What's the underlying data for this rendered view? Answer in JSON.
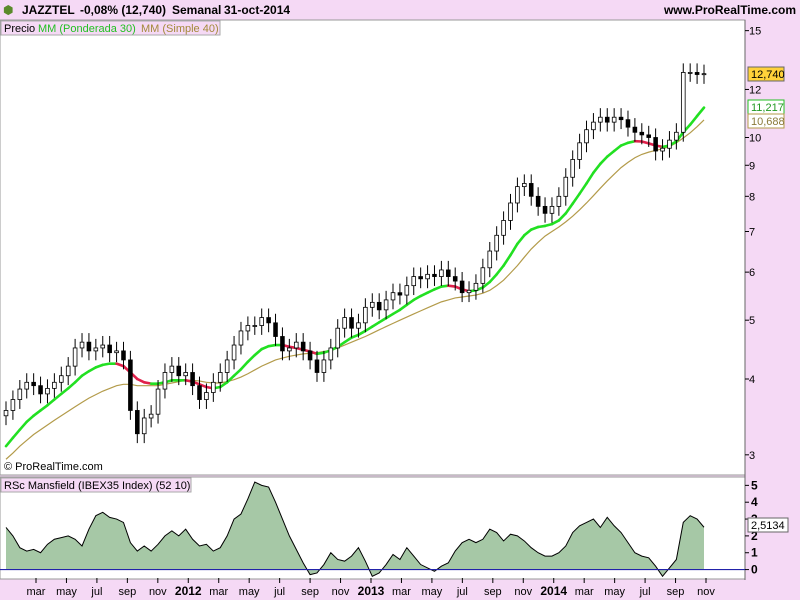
{
  "header": {
    "symbol": "JAZZTEL",
    "change": "-0,08% (12,740)",
    "period": "Semanal",
    "date": "31-oct-2014",
    "site": "www.ProRealTime.com"
  },
  "legend": {
    "price": "Precio",
    "ma1": "MM (Ponderada 30)",
    "ma2": "MM (Simple 40)"
  },
  "watermark": "© ProRealTime.com",
  "indicator_title": "RSc Mansfield (IBEX35 Index) (52 10)",
  "colors": {
    "background": "#f5d9f5",
    "ma1_up": "#22e022",
    "ma1_down": "#e0204a",
    "ma2": "#b39b4a",
    "candle": "#000000",
    "rsc_fill": "#5d9a5d",
    "rsc_zero": "#2222aa"
  },
  "chart_data": [
    {
      "type": "line",
      "panel": "price",
      "scale": "log",
      "ylim": [
        2.8,
        15.5
      ],
      "y_ticks": [
        3,
        4,
        5,
        6,
        7,
        8,
        9,
        10,
        12,
        15
      ],
      "x_ticks": [
        "mar",
        "may",
        "jul",
        "sep",
        "nov",
        "2012",
        "mar",
        "may",
        "jul",
        "sep",
        "nov",
        "2013",
        "mar",
        "may",
        "jul",
        "sep",
        "nov",
        "2014",
        "mar",
        "may",
        "jul",
        "sep",
        "nov"
      ],
      "x_ticks_bold": [
        "2012",
        "2013",
        "2014"
      ],
      "last_price": "12,740",
      "ma1_last": "11,217",
      "ma2_last": "10,688",
      "series": [
        {
          "name": "Precio",
          "values": [
            3.55,
            3.7,
            3.85,
            3.95,
            3.9,
            3.78,
            3.86,
            3.95,
            4.05,
            4.2,
            4.5,
            4.6,
            4.45,
            4.5,
            4.55,
            4.42,
            4.45,
            4.3,
            3.55,
            3.25,
            3.45,
            3.5,
            3.85,
            4.1,
            4.2,
            4.05,
            4.1,
            3.9,
            3.7,
            3.8,
            3.95,
            4.1,
            4.3,
            4.55,
            4.8,
            4.9,
            4.9,
            5.05,
            4.95,
            4.7,
            4.45,
            4.5,
            4.6,
            4.45,
            4.3,
            4.1,
            4.3,
            4.5,
            4.85,
            5.05,
            4.85,
            4.95,
            5.25,
            5.35,
            5.2,
            5.4,
            5.55,
            5.5,
            5.7,
            5.9,
            5.85,
            5.95,
            5.9,
            6.05,
            5.9,
            5.8,
            5.55,
            5.6,
            5.75,
            6.1,
            6.5,
            6.9,
            7.3,
            7.8,
            8.3,
            8.4,
            8.0,
            7.7,
            7.5,
            7.7,
            8.0,
            8.6,
            9.2,
            9.8,
            10.3,
            10.6,
            10.8,
            10.6,
            10.8,
            10.7,
            10.4,
            10.2,
            10.1,
            10.0,
            9.5,
            9.6,
            9.9,
            10.2,
            12.8,
            12.8,
            12.7,
            12.74
          ]
        },
        {
          "name": "MM (Ponderada 30)",
          "values": [
            3.1,
            3.2,
            3.3,
            3.4,
            3.48,
            3.55,
            3.62,
            3.7,
            3.78,
            3.86,
            3.95,
            4.05,
            4.12,
            4.18,
            4.22,
            4.24,
            4.24,
            4.2,
            4.1,
            4.0,
            3.95,
            3.93,
            3.93,
            3.95,
            3.98,
            3.98,
            3.98,
            3.96,
            3.92,
            3.88,
            3.86,
            3.88,
            3.95,
            4.05,
            4.15,
            4.27,
            4.38,
            4.48,
            4.53,
            4.55,
            4.55,
            4.52,
            4.5,
            4.47,
            4.44,
            4.4,
            4.42,
            4.46,
            4.52,
            4.6,
            4.68,
            4.73,
            4.8,
            4.88,
            4.96,
            5.04,
            5.12,
            5.2,
            5.3,
            5.4,
            5.48,
            5.55,
            5.62,
            5.68,
            5.7,
            5.68,
            5.62,
            5.58,
            5.6,
            5.66,
            5.78,
            5.95,
            6.15,
            6.4,
            6.68,
            6.9,
            7.05,
            7.12,
            7.15,
            7.2,
            7.3,
            7.5,
            7.78,
            8.08,
            8.4,
            8.75,
            9.05,
            9.3,
            9.5,
            9.7,
            9.8,
            9.86,
            9.85,
            9.78,
            9.7,
            9.65,
            9.7,
            9.85,
            10.2,
            10.5,
            10.85,
            11.2
          ]
        },
        {
          "name": "MM (Simple 40)",
          "values": [
            2.95,
            3.02,
            3.1,
            3.17,
            3.24,
            3.3,
            3.36,
            3.42,
            3.48,
            3.54,
            3.6,
            3.66,
            3.72,
            3.77,
            3.82,
            3.86,
            3.9,
            3.92,
            3.92,
            3.9,
            3.9,
            3.9,
            3.9,
            3.92,
            3.94,
            3.96,
            3.98,
            3.98,
            3.97,
            3.95,
            3.94,
            3.94,
            3.96,
            3.99,
            4.03,
            4.08,
            4.14,
            4.2,
            4.25,
            4.3,
            4.33,
            4.36,
            4.38,
            4.4,
            4.41,
            4.42,
            4.44,
            4.46,
            4.5,
            4.55,
            4.6,
            4.65,
            4.7,
            4.76,
            4.82,
            4.88,
            4.94,
            5.0,
            5.06,
            5.12,
            5.18,
            5.24,
            5.3,
            5.36,
            5.4,
            5.44,
            5.46,
            5.48,
            5.5,
            5.54,
            5.6,
            5.7,
            5.82,
            5.98,
            6.15,
            6.35,
            6.55,
            6.72,
            6.88,
            7.0,
            7.12,
            7.26,
            7.42,
            7.6,
            7.8,
            8.02,
            8.25,
            8.48,
            8.7,
            8.92,
            9.1,
            9.26,
            9.38,
            9.46,
            9.52,
            9.58,
            9.66,
            9.8,
            9.98,
            10.18,
            10.42,
            10.69
          ]
        }
      ]
    },
    {
      "type": "area",
      "panel": "indicator",
      "ylim": [
        -0.5,
        5.2
      ],
      "y_ticks": [
        "5",
        "4",
        "3",
        "2",
        "1",
        "0"
      ],
      "last_value": "2,5134",
      "series": [
        {
          "name": "RSc Mansfield (IBEX35 Index)",
          "values": [
            2.5,
            2.0,
            1.3,
            1.1,
            1.2,
            1.0,
            1.5,
            1.8,
            1.9,
            2.0,
            1.8,
            1.4,
            2.4,
            3.2,
            3.4,
            3.1,
            3.0,
            2.8,
            1.6,
            1.1,
            1.4,
            1.1,
            1.5,
            2.0,
            2.3,
            2.0,
            2.4,
            1.8,
            1.4,
            1.5,
            1.1,
            1.3,
            2.0,
            3.0,
            3.3,
            4.2,
            5.2,
            5.0,
            4.9,
            4.0,
            3.0,
            2.0,
            1.2,
            0.4,
            -0.3,
            -0.2,
            0.3,
            1.0,
            0.6,
            0.5,
            0.8,
            1.3,
            0.5,
            -0.4,
            -0.2,
            0.3,
            0.9,
            0.6,
            1.3,
            0.8,
            0.3,
            0.1,
            -0.1,
            0.2,
            0.4,
            1.1,
            1.6,
            1.8,
            1.6,
            1.8,
            2.4,
            2.2,
            1.7,
            2.1,
            2.0,
            1.7,
            1.3,
            1.0,
            0.8,
            0.8,
            1.0,
            1.4,
            2.2,
            2.6,
            2.8,
            3.0,
            2.5,
            3.1,
            2.6,
            2.2,
            1.6,
            1.0,
            0.8,
            0.7,
            0.2,
            -0.4,
            0.1,
            0.6,
            2.8,
            3.2,
            3.0,
            2.5134
          ]
        }
      ]
    }
  ]
}
